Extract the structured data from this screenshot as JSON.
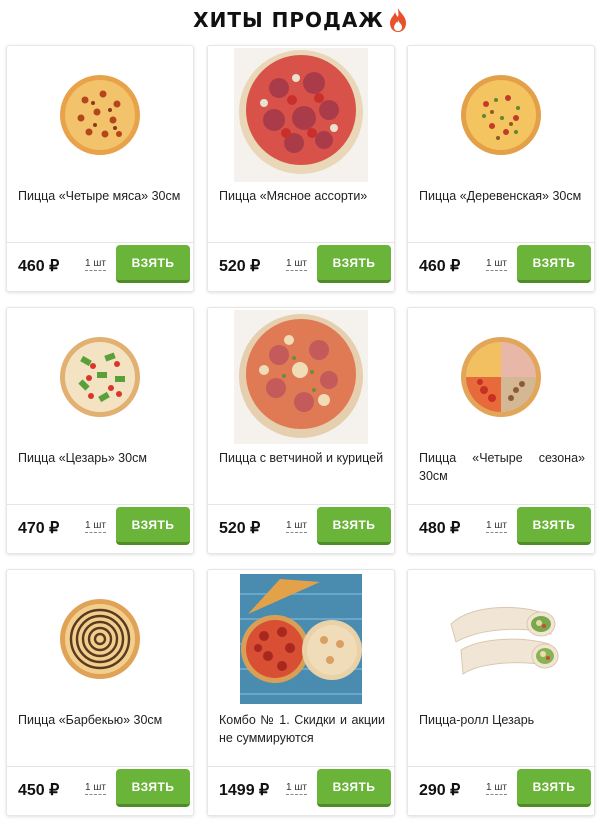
{
  "section_title": "ХИТЫ ПРОДАЖ",
  "title_icon": "fire-icon",
  "buy_label": "ВЗЯТЬ",
  "qty_label": "1 шт",
  "currency": "₽",
  "colors": {
    "button": "#6bb43a",
    "fire": "#e9512b"
  },
  "products": [
    {
      "name": "Пицца «Четыре мяса» 30см",
      "price": "460",
      "image": "pizza-four-meats-image"
    },
    {
      "name": "Пицца «Мясное ассорти»",
      "price": "520",
      "image": "pizza-meat-assorted-image"
    },
    {
      "name": "Пицца «Деревенская» 30см",
      "price": "460",
      "image": "pizza-rustic-image"
    },
    {
      "name": "Пицца «Цезарь» 30см",
      "price": "470",
      "image": "pizza-caesar-image"
    },
    {
      "name": "Пицца с ветчиной и курицей",
      "price": "520",
      "image": "pizza-ham-chicken-image"
    },
    {
      "name": "Пицца «Четыре сезона» 30см",
      "price": "480",
      "image": "pizza-four-seasons-image"
    },
    {
      "name": "Пицца «Барбекью» 30см",
      "price": "450",
      "image": "pizza-bbq-image"
    },
    {
      "name": "Комбо № 1. Скидки и акции не суммируются",
      "price": "1499",
      "image": "combo-image"
    },
    {
      "name": "Пицца-ролл Цезарь",
      "price": "290",
      "image": "pizza-roll-image"
    }
  ]
}
